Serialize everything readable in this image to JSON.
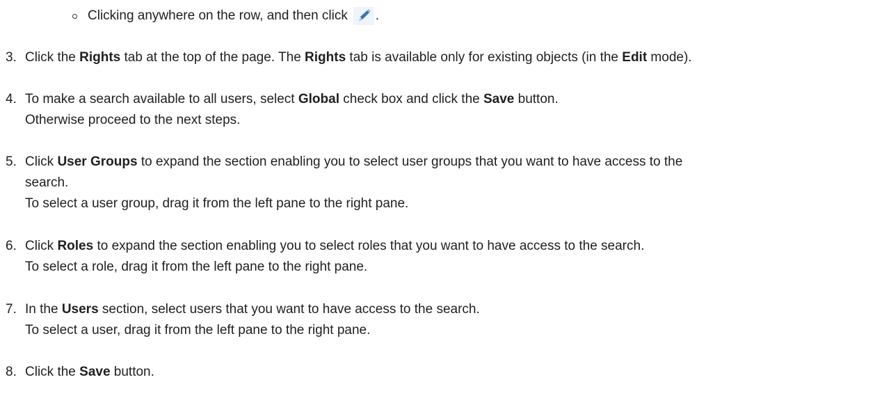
{
  "sub_bullet": {
    "before_icon": "Clicking anywhere on the row, and then click",
    "after_icon": ".",
    "icon": "pencil-edit-icon",
    "icon_colors": {
      "pencil": "#3d73b5",
      "highlight": "#cfe0f4"
    }
  },
  "steps": [
    {
      "number": "3.",
      "line1": {
        "t1": "Click the ",
        "b1": "Rights",
        "t2": " tab at the top of the page. The ",
        "b2": "Rights",
        "t3": " tab is available only for existing objects (in the ",
        "b3": "Edit",
        "t4": " mode)."
      }
    },
    {
      "number": "4.",
      "line1": {
        "t1": "To make a search available to all users, select ",
        "b1": "Global",
        "t2": " check box and click the ",
        "b2": "Save",
        "t3": " button."
      },
      "line2": "Otherwise proceed to the next steps."
    },
    {
      "number": "5.",
      "line1": {
        "t1": "Click ",
        "b1": "User Groups",
        "t2": " to expand the section enabling you to select user groups that you want to have access to the"
      },
      "line2": "search.",
      "line3": "To select a user group, drag it from the left pane to the right pane."
    },
    {
      "number": "6.",
      "line1": {
        "t1": "Click ",
        "b1": "Roles",
        "t2": " to expand the section enabling you to select roles that you want to have access to the search."
      },
      "line2": "To select a role, drag it from the left pane to the right pane."
    },
    {
      "number": "7.",
      "line1": {
        "t1": "In the ",
        "b1": "Users",
        "t2": " section, select users that you want to have access to the search."
      },
      "line2": "To select a user, drag it from the left pane to the right pane."
    },
    {
      "number": "8.",
      "line1": {
        "t1": "Click the ",
        "b1": "Save",
        "t2": " button."
      }
    }
  ]
}
